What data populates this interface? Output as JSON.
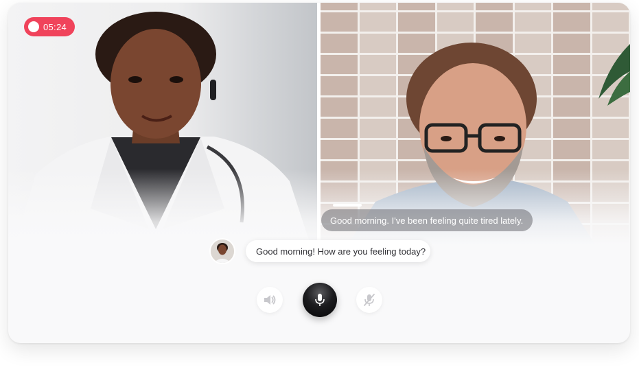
{
  "recording": {
    "time": "05:24"
  },
  "patient_caption": "Good morning. I've been feeling quite tired lately.",
  "doctor_caption": "Good morning! How are you feeling today?",
  "controls": {
    "speaker_icon": "speaker-icon",
    "mic_icon": "microphone-icon",
    "mute_icon": "microphone-off-icon"
  },
  "colors": {
    "recording_badge": "#f0435b",
    "mic_button": "#111114",
    "card_background": "#f9f9fa"
  }
}
